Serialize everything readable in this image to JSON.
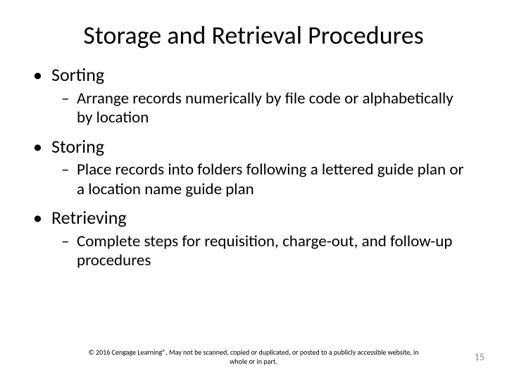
{
  "title": "Storage and Retrieval Procedures",
  "items": [
    {
      "label": "Sorting",
      "sub": "Arrange records numerically by file code or alphabetically by location"
    },
    {
      "label": "Storing",
      "sub": "Place records into folders following a lettered guide plan or a location name guide plan"
    },
    {
      "label": "Retrieving",
      "sub": "Complete steps for requisition, charge-out, and follow-up procedures"
    }
  ],
  "footer": "© 2016 Cengage Learning®. May not be scanned, copied or duplicated, or posted to a publicly accessible website, in whole or in part.",
  "page_number": "15"
}
